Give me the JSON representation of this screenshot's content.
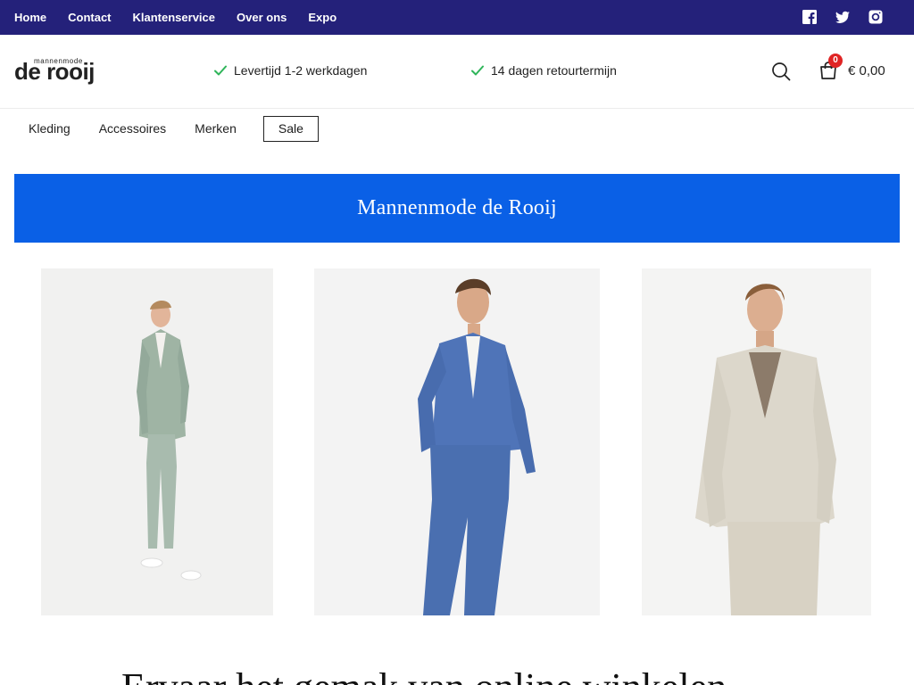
{
  "topbar": {
    "links": [
      "Home",
      "Contact",
      "Klantenservice",
      "Over ons",
      "Expo"
    ],
    "social": [
      "facebook-icon",
      "twitter-icon",
      "instagram-icon"
    ],
    "color": "#24217a"
  },
  "header": {
    "logo_small": "mannenmode",
    "logo_big": "de rooij",
    "usp1": "Levertijd 1-2 werkdagen",
    "usp2": "14 dagen retourtermijn",
    "cart_count": "0",
    "cart_total": "€ 0,00",
    "check_color": "#2fb55a"
  },
  "catnav": {
    "items": [
      "Kleding",
      "Accessoires",
      "Merken"
    ],
    "sale": "Sale"
  },
  "banner": {
    "text": "Mannenmode de Rooij",
    "color": "#0a60e6"
  },
  "bottom_heading": "Ervaar het gemak van online winkelen"
}
